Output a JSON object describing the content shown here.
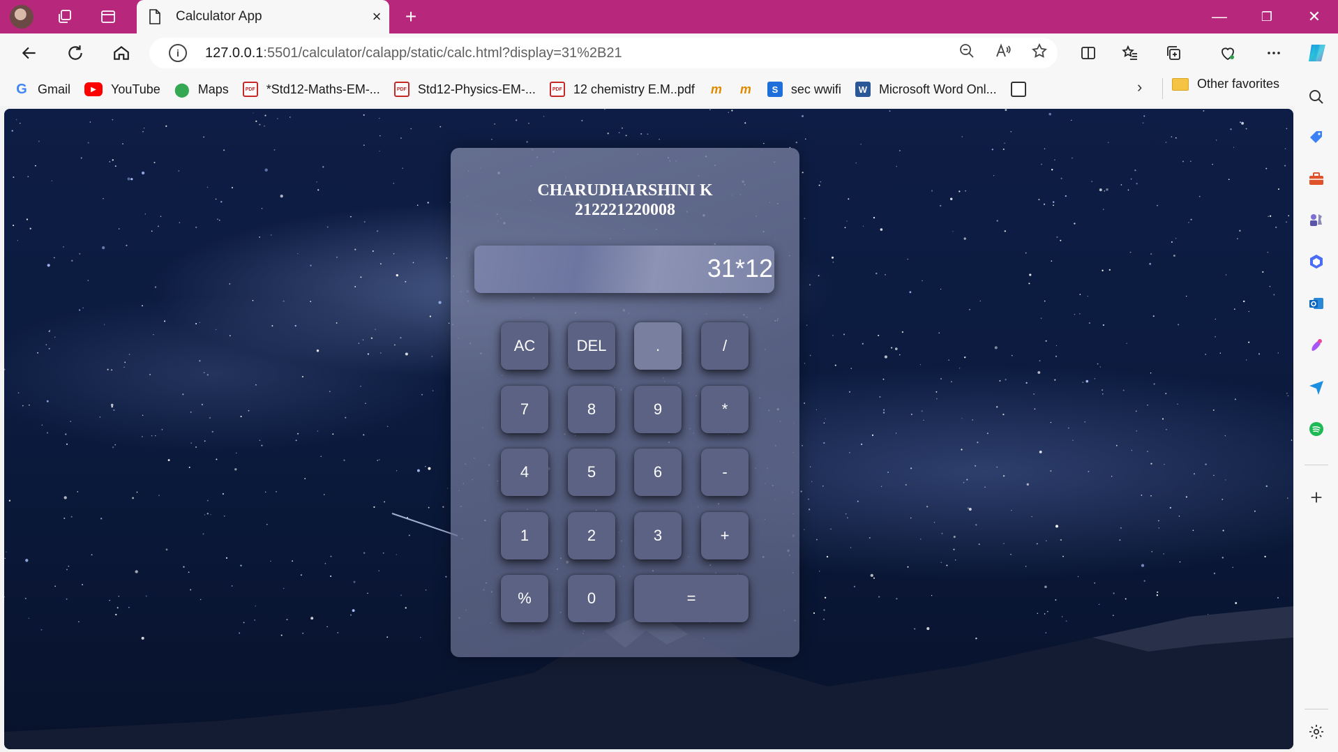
{
  "browser": {
    "tab_title": "Calculator App",
    "tab_close": "×",
    "new_tab": "+",
    "window_controls": {
      "minimize": "—",
      "restore": "❐",
      "close": "✕"
    },
    "url_host": "127.0.0.1",
    "url_rest": ":5501/calculator/calapp/static/calc.html?display=31%2B21",
    "accent_color": "#b7277b"
  },
  "favorites": {
    "items": [
      {
        "label": "Gmail",
        "icon": "google-icon"
      },
      {
        "label": "YouTube",
        "icon": "youtube-icon"
      },
      {
        "label": "Maps",
        "icon": "maps-icon"
      },
      {
        "label": "*Std12-Maths-EM-...",
        "icon": "pdf-icon"
      },
      {
        "label": "Std12-Physics-EM-...",
        "icon": "pdf-icon"
      },
      {
        "label": "12 chemistry E.M..pdf",
        "icon": "pdf-icon"
      },
      {
        "label": "",
        "icon": "m-icon"
      },
      {
        "label": "",
        "icon": "m-icon"
      },
      {
        "label": "sec wwifi",
        "icon": "s-icon"
      },
      {
        "label": "Microsoft Word Onl...",
        "icon": "word-icon"
      },
      {
        "label": "",
        "icon": "document-icon"
      }
    ],
    "other": "Other favorites"
  },
  "calculator": {
    "name": "CHARUDHARSHINI K",
    "id": "212221220008",
    "display": "31*12",
    "keys": {
      "ac": "AC",
      "del": "DEL",
      "dot": ".",
      "divide": "/",
      "seven": "7",
      "eight": "8",
      "nine": "9",
      "multiply": "*",
      "four": "4",
      "five": "5",
      "six": "6",
      "minus": "-",
      "one": "1",
      "two": "2",
      "three": "3",
      "plus": "+",
      "percent": "%",
      "zero": "0",
      "equals": "="
    }
  }
}
